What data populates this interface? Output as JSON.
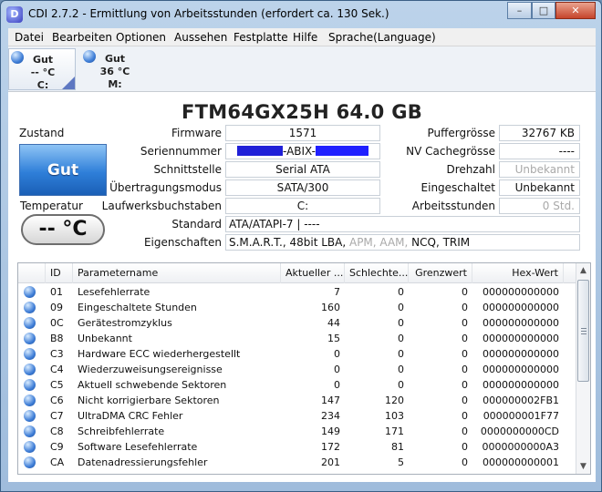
{
  "window": {
    "icon_letter": "D",
    "title": "CDI 2.7.2 - Ermittlung von Arbeitsstunden (erfordert ca. 130 Sek.)",
    "minimize": "–",
    "maximize": "□",
    "close": "✕"
  },
  "menu": [
    "Datei",
    "Bearbeiten",
    "Optionen",
    "Aussehen",
    "Festplatte",
    "Hilfe",
    "Sprache(Language)"
  ],
  "drives": [
    {
      "status": "Gut",
      "temp": "-- °C",
      "letter": "C:"
    },
    {
      "status": "Gut",
      "temp": "36 °C",
      "letter": "M:"
    }
  ],
  "disk": {
    "model": "FTM64GX25H  64.0 GB",
    "firmware_label": "Firmware",
    "firmware": "1571",
    "serial_label": "Seriennummer",
    "serial_visible": "-ABIX-",
    "interface_label": "Schnittstelle",
    "interface": "Serial ATA",
    "transfer_label": "Übertragungsmodus",
    "transfer": "SATA/300",
    "letters_label": "Laufwerksbuchstaben",
    "letters": "C:",
    "standard_label": "Standard",
    "standard": "ATA/ATAPI-7 | ----",
    "features_label": "Eigenschaften",
    "features_active": "S.M.A.R.T., 48bit LBA, ",
    "features_inactive": "APM, AAM,",
    "features_active2": " NCQ, TRIM",
    "buffer_label": "Puffergrösse",
    "buffer": "32767 KB",
    "nvcache_label": "NV Cachegrösse",
    "nvcache": "----",
    "rotation_label": "Drehzahl",
    "rotation": "Unbekannt",
    "poweron_count_label": "Eingeschaltet",
    "poweron_count": "Unbekannt",
    "hours_label": "Arbeitsstunden",
    "hours": "0 Std."
  },
  "status": {
    "label": "Zustand",
    "value": "Gut",
    "temp_label": "Temperatur",
    "temp_value": "-- °C"
  },
  "table": {
    "headers": [
      "ID",
      "Parametername",
      "Aktueller ...",
      "Schlechte...",
      "Grenzwert",
      "Hex-Wert"
    ],
    "rows": [
      {
        "id": "01",
        "name": "Lesefehlerrate",
        "cur": "7",
        "worst": "0",
        "thr": "0",
        "hex": "000000000000"
      },
      {
        "id": "09",
        "name": "Eingeschaltete Stunden",
        "cur": "160",
        "worst": "0",
        "thr": "0",
        "hex": "000000000000"
      },
      {
        "id": "0C",
        "name": "Gerätestromzyklus",
        "cur": "44",
        "worst": "0",
        "thr": "0",
        "hex": "000000000000"
      },
      {
        "id": "B8",
        "name": "Unbekannt",
        "cur": "15",
        "worst": "0",
        "thr": "0",
        "hex": "000000000000"
      },
      {
        "id": "C3",
        "name": "Hardware ECC wiederhergestellt",
        "cur": "0",
        "worst": "0",
        "thr": "0",
        "hex": "000000000000"
      },
      {
        "id": "C4",
        "name": "Wiederzuweisungsereignisse",
        "cur": "0",
        "worst": "0",
        "thr": "0",
        "hex": "000000000000"
      },
      {
        "id": "C5",
        "name": "Aktuell schwebende Sektoren",
        "cur": "0",
        "worst": "0",
        "thr": "0",
        "hex": "000000000000"
      },
      {
        "id": "C6",
        "name": "Nicht korrigierbare Sektoren",
        "cur": "147",
        "worst": "120",
        "thr": "0",
        "hex": "000000002FB1"
      },
      {
        "id": "C7",
        "name": "UltraDMA CRC Fehler",
        "cur": "234",
        "worst": "103",
        "thr": "0",
        "hex": "000000001F77"
      },
      {
        "id": "C8",
        "name": "Schreibfehlerrate",
        "cur": "149",
        "worst": "171",
        "thr": "0",
        "hex": "0000000000CD"
      },
      {
        "id": "C9",
        "name": "Software Lesefehlerrate",
        "cur": "172",
        "worst": "81",
        "thr": "0",
        "hex": "0000000000A3"
      },
      {
        "id": "CA",
        "name": "Datenadressierungsfehler",
        "cur": "201",
        "worst": "5",
        "thr": "0",
        "hex": "000000000001"
      }
    ]
  },
  "scrollbar": {
    "up": "▲",
    "down": "▼"
  }
}
